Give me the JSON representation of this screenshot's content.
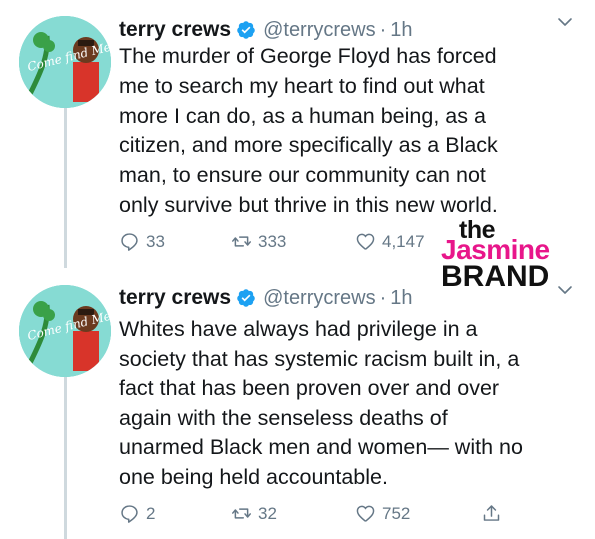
{
  "tweets": [
    {
      "author": {
        "display_name": "terry crews",
        "handle": "@terrycrews",
        "separator": "·",
        "time": "1h",
        "avatar_icon": "avatar-image",
        "avatar_text": "Come find Me",
        "verified": true
      },
      "text": "The murder of George Floyd has forced\nme to search my heart to find out what\nmore I can do, as a human being, as a\ncitizen, and more specifically as a Black\nman, to ensure our community can not\nonly survive but thrive in this new world.",
      "actions": {
        "reply_count": "33",
        "retweet_count": "333",
        "like_count": "4,147"
      }
    },
    {
      "author": {
        "display_name": "terry crews",
        "handle": "@terrycrews",
        "separator": "·",
        "time": "1h",
        "avatar_icon": "avatar-image",
        "avatar_text": "Come find Me",
        "verified": true
      },
      "text": "Whites have always had privilege in a\nsociety that has systemic racism built in, a\nfact that has been proven over and over\nagain  with the senseless deaths of\nunarmed Black men and women— with no\none being held accountable.",
      "actions": {
        "reply_count": "2",
        "retweet_count": "32",
        "like_count": "752"
      }
    }
  ],
  "watermark": {
    "line1": "the",
    "line2": "Jasmine",
    "line3": "BRAND"
  },
  "colors": {
    "text": "#14171a",
    "muted": "#657786",
    "verified": "#1da1f2",
    "thread_line": "#cfd9de",
    "watermark_pink": "#e8168a"
  },
  "icons": [
    "verified-icon",
    "chevron-down-icon",
    "reply-icon",
    "retweet-icon",
    "like-icon",
    "share-icon"
  ]
}
